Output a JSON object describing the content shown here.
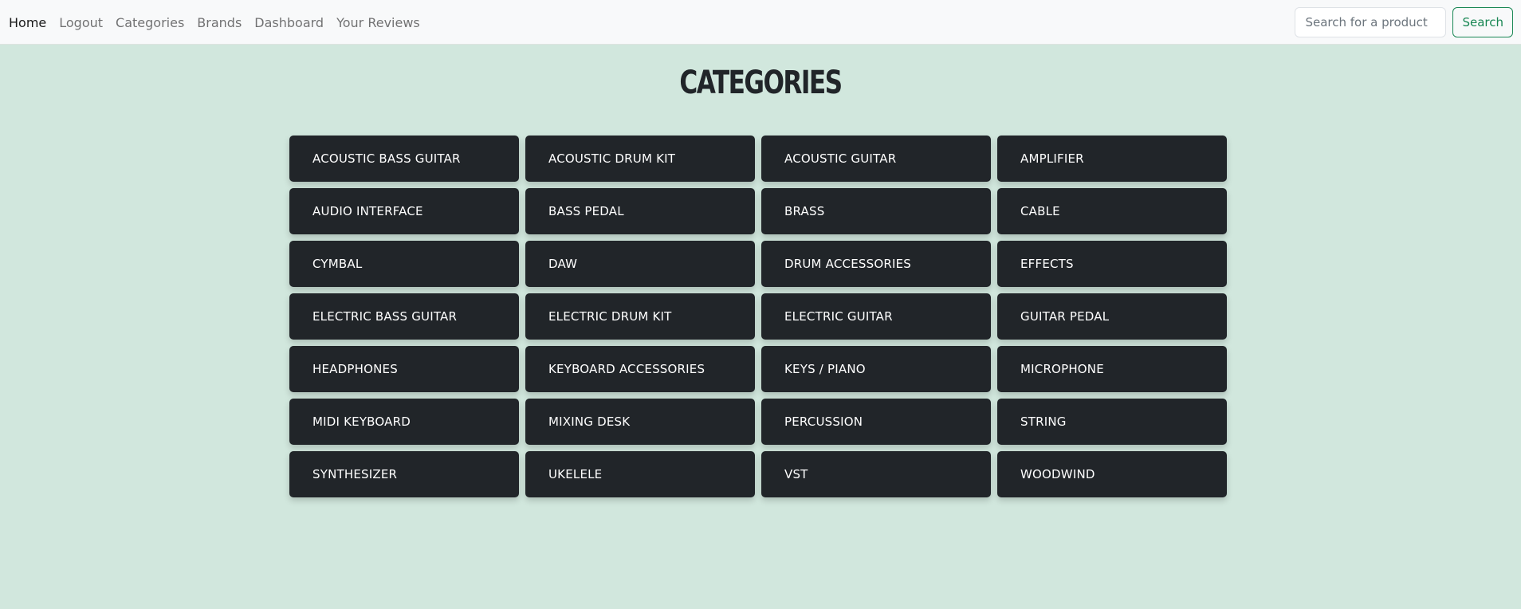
{
  "nav": {
    "links": [
      {
        "label": "Home",
        "active": true
      },
      {
        "label": "Logout",
        "active": false
      },
      {
        "label": "Categories",
        "active": false
      },
      {
        "label": "Brands",
        "active": false
      },
      {
        "label": "Dashboard",
        "active": false
      },
      {
        "label": "Your Reviews",
        "active": false
      }
    ],
    "search": {
      "placeholder": "Search for a product",
      "value": "",
      "button_label": "Search"
    }
  },
  "page": {
    "title": "CATEGORIES"
  },
  "categories": [
    "ACOUSTIC BASS GUITAR",
    "ACOUSTIC DRUM KIT",
    "ACOUSTIC GUITAR",
    "AMPLIFIER",
    "AUDIO INTERFACE",
    "BASS PEDAL",
    "BRASS",
    "CABLE",
    "CYMBAL",
    "DAW",
    "DRUM ACCESSORIES",
    "EFFECTS",
    "ELECTRIC BASS GUITAR",
    "ELECTRIC DRUM KIT",
    "ELECTRIC GUITAR",
    "GUITAR PEDAL",
    "HEADPHONES",
    "KEYBOARD ACCESSORIES",
    "KEYS / PIANO",
    "MICROPHONE",
    "MIDI KEYBOARD",
    "MIXING DESK",
    "PERCUSSION",
    "STRING",
    "SYNTHESIZER",
    "UKELELE",
    "VST",
    "WOODWIND"
  ],
  "colors": {
    "page_background": "#d1e7dd",
    "navbar_background": "#f8f9fa",
    "button_dark": "#212529",
    "search_accent": "#198754"
  }
}
